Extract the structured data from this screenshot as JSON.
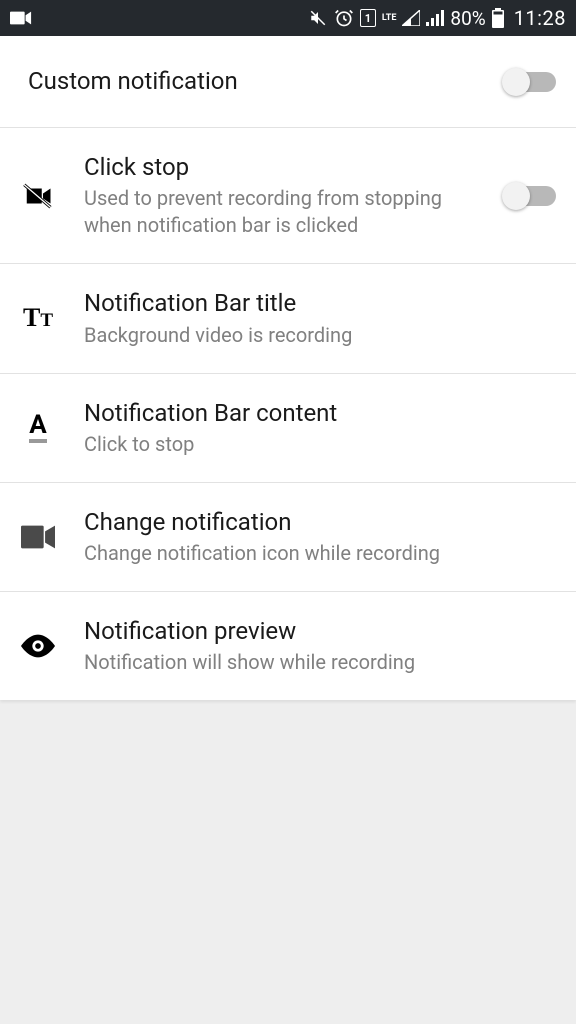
{
  "statusbar": {
    "battery": "80%",
    "time": "11:28",
    "lte": "LTE"
  },
  "settings": {
    "custom_notification": {
      "title": "Custom notification"
    },
    "click_stop": {
      "title": "Click stop",
      "subtitle": "Used to prevent recording from stopping when notification bar is clicked"
    },
    "bar_title": {
      "title": "Notification Bar title",
      "subtitle": "Background video is recording"
    },
    "bar_content": {
      "title": "Notification Bar content",
      "subtitle": "Click to stop"
    },
    "change_notification": {
      "title": "Change notification",
      "subtitle": "Change notification icon while recording"
    },
    "preview": {
      "title": "Notification preview",
      "subtitle": "Notification will show while recording"
    }
  }
}
